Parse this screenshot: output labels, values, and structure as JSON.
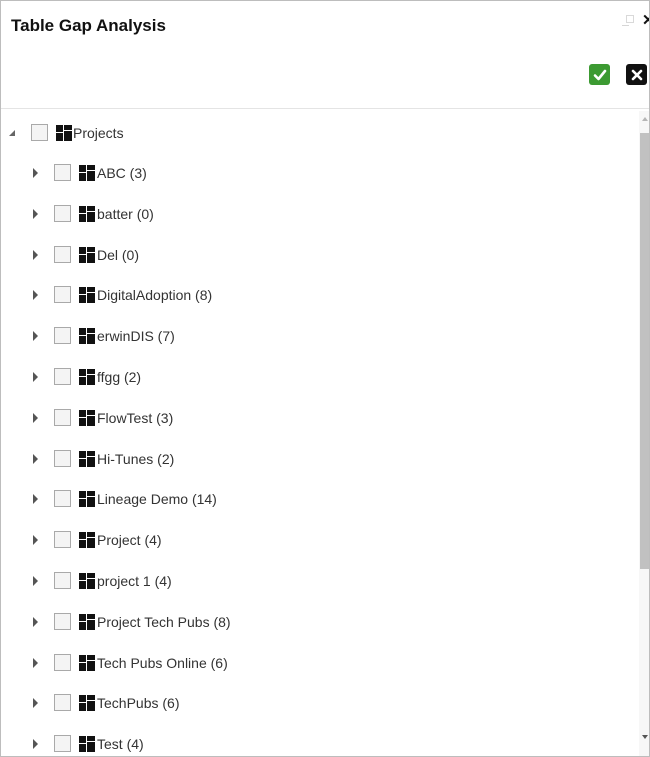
{
  "dialog": {
    "title": "Table Gap Analysis",
    "window_controls": [
      "minimize-icon",
      "maximize-icon",
      "close-icon"
    ],
    "close_glyph": "✕"
  },
  "toolbar": {
    "ok_icon": "checkmark-icon",
    "cancel_icon": "x-icon",
    "ok_color": "#3c9a32",
    "cancel_color": "#111111"
  },
  "tree": {
    "root": {
      "label": "Projects",
      "expanded": true,
      "checked": false
    },
    "items": [
      {
        "label": "ABC (3)"
      },
      {
        "label": "batter (0)"
      },
      {
        "label": "Del (0)"
      },
      {
        "label": "DigitalAdoption (8)"
      },
      {
        "label": "erwinDIS (7)"
      },
      {
        "label": "ffgg (2)"
      },
      {
        "label": "FlowTest (3)"
      },
      {
        "label": "Hi-Tunes (2)"
      },
      {
        "label": "Lineage Demo (14)"
      },
      {
        "label": "Project (4)"
      },
      {
        "label": "project 1 (4)"
      },
      {
        "label": "Project Tech Pubs (8)"
      },
      {
        "label": "Tech Pubs Online (6)"
      },
      {
        "label": "TechPubs (6)"
      },
      {
        "label": "Test (4)"
      }
    ]
  }
}
